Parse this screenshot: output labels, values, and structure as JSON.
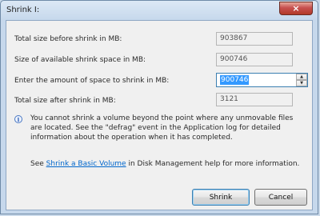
{
  "window": {
    "title": "Shrink I:",
    "close_glyph": "×"
  },
  "form": {
    "rows": [
      {
        "label": "Total size before shrink in MB:",
        "value": "903867"
      },
      {
        "label": "Size of available shrink space in MB:",
        "value": "900746"
      },
      {
        "label": "Enter the amount of space to shrink in MB:",
        "value": "900746"
      },
      {
        "label": "Total size after shrink in MB:",
        "value": "3121"
      }
    ]
  },
  "info": {
    "icon": "info-icon",
    "glyph": "i",
    "text": "You cannot shrink a volume beyond the point where any unmovable files are located. See the \"defrag\" event in the Application log for detailed information about the operation when it has completed."
  },
  "help": {
    "prefix": "See ",
    "link": "Shrink a Basic Volume",
    "suffix": " in Disk Management help for more information."
  },
  "buttons": {
    "shrink": "Shrink",
    "cancel": "Cancel"
  },
  "colors": {
    "selection": "#3399ff",
    "link": "#0066cc",
    "close": "#c75050"
  }
}
